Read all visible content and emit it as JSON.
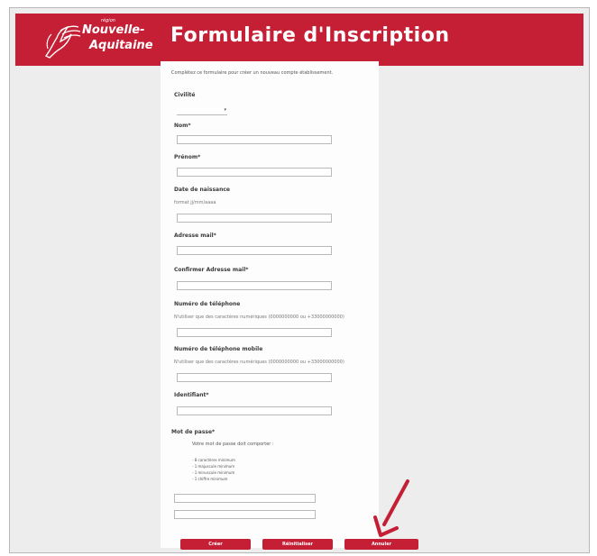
{
  "header": {
    "title": "Formulaire d'Inscription",
    "logo": {
      "region_word": "région",
      "line1": "Nouvelle-",
      "line2": "Aquitaine"
    }
  },
  "form": {
    "intro": "Complétez ce formulaire pour créer un nouveau compte établissement.",
    "civilite": {
      "label": "Civilité",
      "value": ""
    },
    "nom": {
      "label": "Nom*",
      "value": ""
    },
    "prenom": {
      "label": "Prénom*",
      "value": ""
    },
    "naissance": {
      "label": "Date de naissance",
      "hint": "format jj/mm/aaaa",
      "value": ""
    },
    "email": {
      "label": "Adresse mail*",
      "value": ""
    },
    "email_confirm": {
      "label": "Confirmer Adresse mail*",
      "value": ""
    },
    "telephone": {
      "label": "Numéro de téléphone",
      "hint": "N'utiliser que des caractères numériques (0000000000 ou +33000000000)",
      "value": ""
    },
    "mobile": {
      "label": "Numéro de téléphone mobile",
      "hint": "N'utiliser que des caractères numériques (0000000000 ou +33000000000)",
      "value": ""
    },
    "identifiant": {
      "label": "Identifiant*",
      "value": ""
    },
    "password": {
      "label": "Mot de passe*",
      "note": "Votre mot de passe doit comporter :",
      "rules": [
        "- 8 caractères minimum",
        "- 1 majuscule minimum",
        "- 1 minuscule minimum",
        "- 1 chiffre minimum"
      ],
      "value": "",
      "confirm_value": ""
    }
  },
  "buttons": {
    "create": "Créer",
    "reset": "Réinitialiser",
    "cancel": "Annuler"
  },
  "colors": {
    "brand": "#c51f36",
    "arrow": "#c51f36"
  }
}
